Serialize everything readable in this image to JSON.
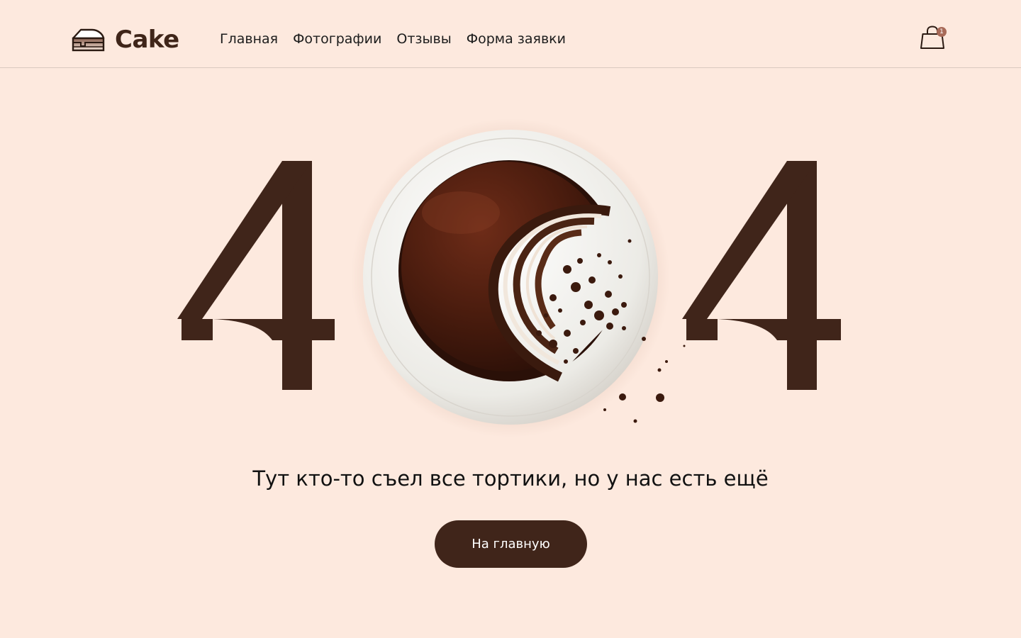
{
  "brand": {
    "name": "Cake",
    "logo_icon": "cake-slice-icon"
  },
  "nav": {
    "items": [
      {
        "label": "Главная"
      },
      {
        "label": "Фотографии"
      },
      {
        "label": "Отзывы"
      },
      {
        "label": "Форма заявки"
      }
    ]
  },
  "cart": {
    "icon": "shopping-bag-icon",
    "count": "1"
  },
  "error": {
    "code_left": "4",
    "code_right": "4",
    "illustration": "chocolate-cake-plate"
  },
  "message": "Тут кто-то съел все тортики, но у нас есть ещё",
  "cta": {
    "label": "На главную"
  },
  "colors": {
    "background": "#fde9de",
    "brand_brown": "#40251a",
    "badge": "#a86a58"
  }
}
